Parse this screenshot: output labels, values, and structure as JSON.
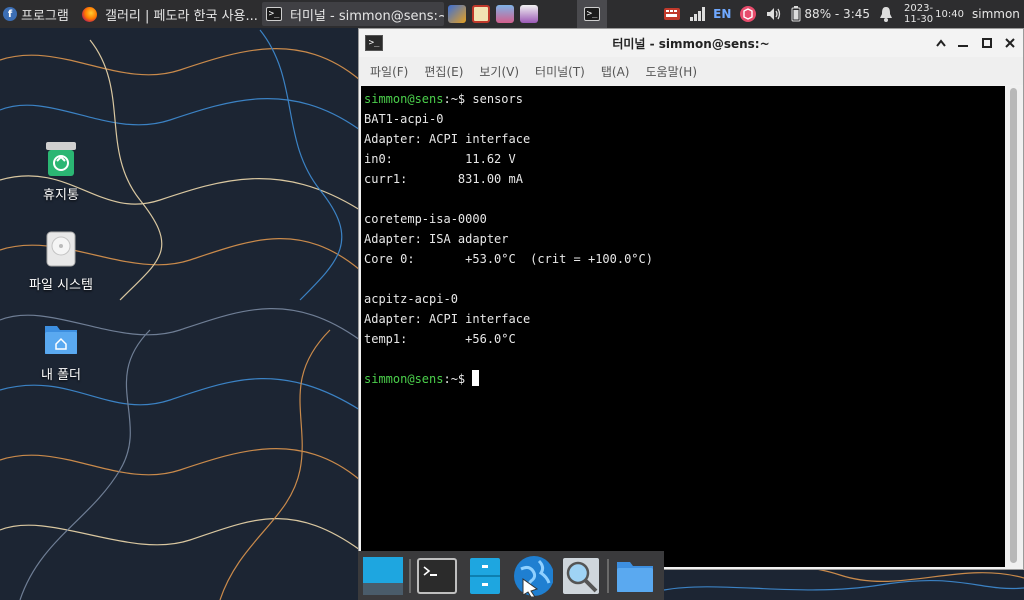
{
  "panel": {
    "apps_menu_label": "프로그램",
    "tasks": [
      {
        "label": "갤러리 | 페도라 한국 사용..."
      },
      {
        "label": "터미널 - simmon@sens:~"
      }
    ],
    "tray": {
      "language": "EN",
      "battery": "88% - 3:45",
      "date": "2023-11-30",
      "time": "10:40",
      "username": "simmon"
    }
  },
  "desktop_icons": [
    {
      "label": "휴지통",
      "icon": "trash-icon"
    },
    {
      "label": "파일 시스템",
      "icon": "drive-icon"
    },
    {
      "label": "내 폴더",
      "icon": "home-folder-icon"
    }
  ],
  "terminal_window": {
    "title": "터미널 - simmon@sens:~",
    "menu": [
      "파일(F)",
      "편집(E)",
      "보기(V)",
      "터미널(T)",
      "탭(A)",
      "도움말(H)"
    ],
    "prompt_user": "simmon@sens",
    "prompt_path": ":~$ ",
    "command": "sensors",
    "output_lines": [
      "BAT1-acpi-0",
      "Adapter: ACPI interface",
      "in0:          11.62 V",
      "curr1:       831.00 mA",
      "",
      "coretemp-isa-0000",
      "Adapter: ISA adapter",
      "Core 0:       +53.0°C  (crit = +100.0°C)",
      "",
      "acpitz-acpi-0",
      "Adapter: ACPI interface",
      "temp1:        +56.0°C",
      ""
    ]
  },
  "dock_items": [
    {
      "icon": "show-desktop-icon"
    },
    {
      "icon": "terminal-icon"
    },
    {
      "icon": "file-cabinet-icon"
    },
    {
      "icon": "web-browser-icon"
    },
    {
      "icon": "search-icon"
    },
    {
      "icon": "folder-icon"
    }
  ],
  "colors": {
    "prompt_green": "#4bcf4b",
    "panel_bg": "#2d2d2f",
    "terminal_bg": "#000000"
  }
}
